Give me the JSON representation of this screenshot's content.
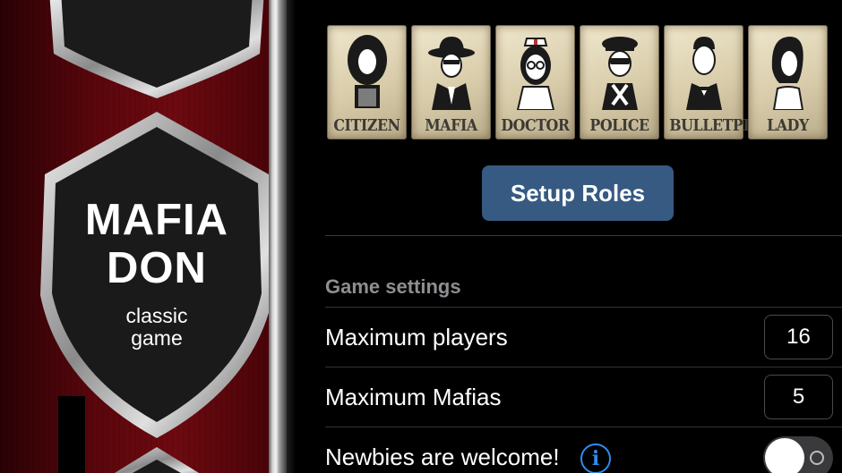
{
  "banner": {
    "title_line1": "MAFIA",
    "title_line2": "DON",
    "subtitle_line1": "classic",
    "subtitle_line2": "game"
  },
  "roles": [
    {
      "name": "CITIZEN",
      "icon": "citizen-icon"
    },
    {
      "name": "MAFIA",
      "icon": "mafia-icon"
    },
    {
      "name": "DOCTOR",
      "icon": "doctor-icon"
    },
    {
      "name": "POLICE",
      "icon": "police-icon"
    },
    {
      "name": "BULLETPROOF",
      "icon": "bulletproof-icon"
    },
    {
      "name": "LADY",
      "icon": "lady-icon"
    }
  ],
  "setup_roles_label": "Setup Roles",
  "settings": {
    "section_title": "Game settings",
    "max_players": {
      "label": "Maximum players",
      "value": "16"
    },
    "max_mafias": {
      "label": "Maximum Mafias",
      "value": "5"
    },
    "newbies": {
      "label": "Newbies are welcome!",
      "info_glyph": "i",
      "enabled": false
    }
  },
  "colors": {
    "button": "#365a82",
    "info": "#2f8af2",
    "banner": "#6e0a10"
  }
}
